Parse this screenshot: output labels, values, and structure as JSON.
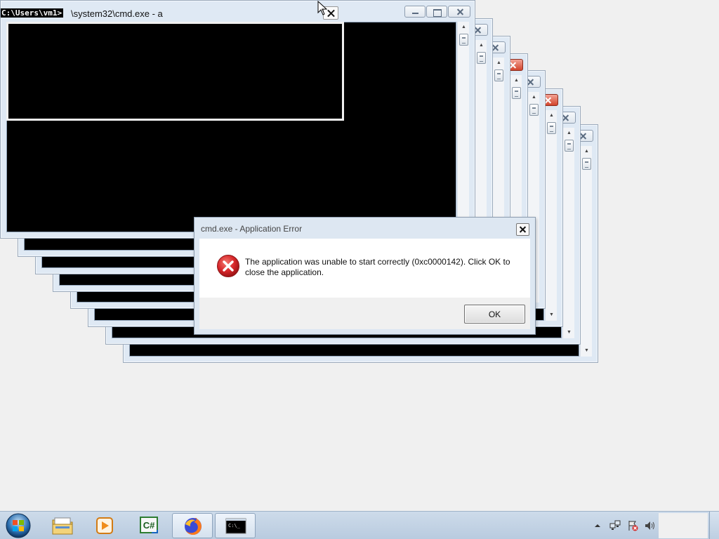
{
  "front_window": {
    "prompt_highlight": "C:\\Users\\vm1>",
    "title_tail": "\\system32\\cmd.exe - a"
  },
  "dialog": {
    "title": "cmd.exe - Application Error",
    "message": "The application was unable to start correctly (0xc0000142). Click OK to close the application.",
    "ok_label": "OK",
    "icon": "error-icon"
  },
  "taskbar": {
    "pinned": [
      {
        "name": "explorer",
        "icon": "folder-icon"
      },
      {
        "name": "media-player",
        "icon": "media-player-icon"
      },
      {
        "name": "csharp",
        "icon": "csharp-icon",
        "label": "C#"
      },
      {
        "name": "firefox",
        "icon": "firefox-icon"
      },
      {
        "name": "cmd",
        "icon": "cmd-icon",
        "label": "C:\\_"
      }
    ],
    "tray": [
      "show-hidden-icons-icon",
      "network-icon",
      "action-center-icon",
      "volume-icon"
    ]
  },
  "colors": {
    "window_frame": "#dfe9f4",
    "console_bg": "#000000",
    "close_red": "#d2442c",
    "error_red": "#d7272a",
    "desktop": "#f0f0f0"
  }
}
